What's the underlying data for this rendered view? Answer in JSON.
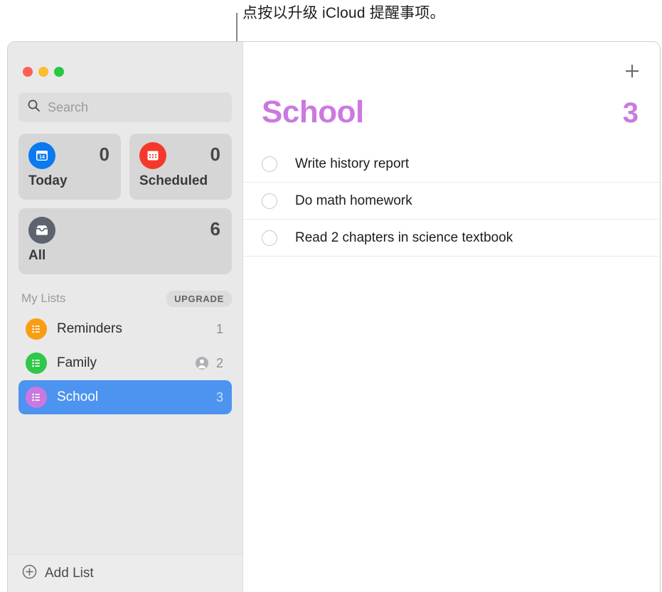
{
  "callout": {
    "text": "点按以升级 iCloud 提醒事项。"
  },
  "window": {
    "traffic_lights": [
      "close",
      "minimize",
      "zoom"
    ]
  },
  "sidebar": {
    "search": {
      "placeholder": "Search",
      "value": ""
    },
    "smart_lists": [
      {
        "label": "Today",
        "count": "0",
        "icon": "calendar-day-icon",
        "color": "#0b79ef"
      },
      {
        "label": "Scheduled",
        "count": "0",
        "icon": "calendar-grid-icon",
        "color": "#f5382b"
      },
      {
        "label": "All",
        "count": "6",
        "icon": "inbox-tray-icon",
        "color": "#5d646d"
      }
    ],
    "my_lists": {
      "header": "My Lists",
      "upgrade_label": "UPGRADE",
      "items": [
        {
          "label": "Reminders",
          "count": "1",
          "color": "#fa9d12",
          "shared": false,
          "selected": false
        },
        {
          "label": "Family",
          "count": "2",
          "color": "#2fc84a",
          "shared": true,
          "selected": false
        },
        {
          "label": "School",
          "count": "3",
          "color": "#cb79e0",
          "shared": false,
          "selected": true
        }
      ]
    },
    "add_list_label": "Add List"
  },
  "content": {
    "title": "School",
    "count": "3",
    "accent_color": "#cb79e0",
    "add_button": "+",
    "reminders": [
      {
        "text": "Write history report",
        "completed": false
      },
      {
        "text": "Do math homework",
        "completed": false
      },
      {
        "text": "Read 2 chapters in science textbook",
        "completed": false
      }
    ]
  }
}
